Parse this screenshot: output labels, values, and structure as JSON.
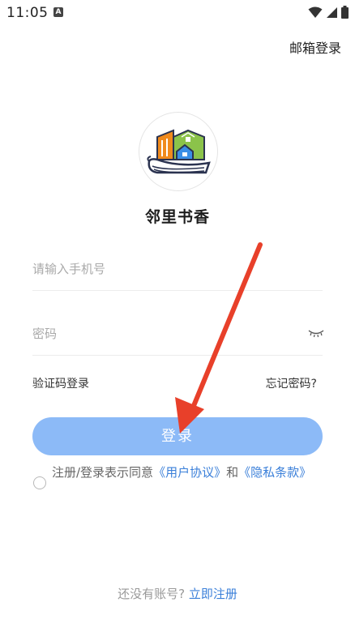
{
  "status_bar": {
    "time": "11:05",
    "badge": "A"
  },
  "header": {
    "email_login": "邮箱登录"
  },
  "app": {
    "name": "邻里书香"
  },
  "form": {
    "phone_placeholder": "请输入手机号",
    "password_placeholder": "密码",
    "sms_login": "验证码登录",
    "forgot_password": "忘记密码?",
    "login_button": "登录"
  },
  "agreement": {
    "prefix": "注册/登录表示同意",
    "user_agreement": "《用户协议》",
    "conjunction": "和",
    "privacy_policy": "《隐私条款》"
  },
  "footer": {
    "no_account": "还没有账号?",
    "register": "立即注册"
  },
  "colors": {
    "primary": "#8cbaf7",
    "link": "#3a7fd9",
    "annotation_arrow": "#e8402a"
  }
}
